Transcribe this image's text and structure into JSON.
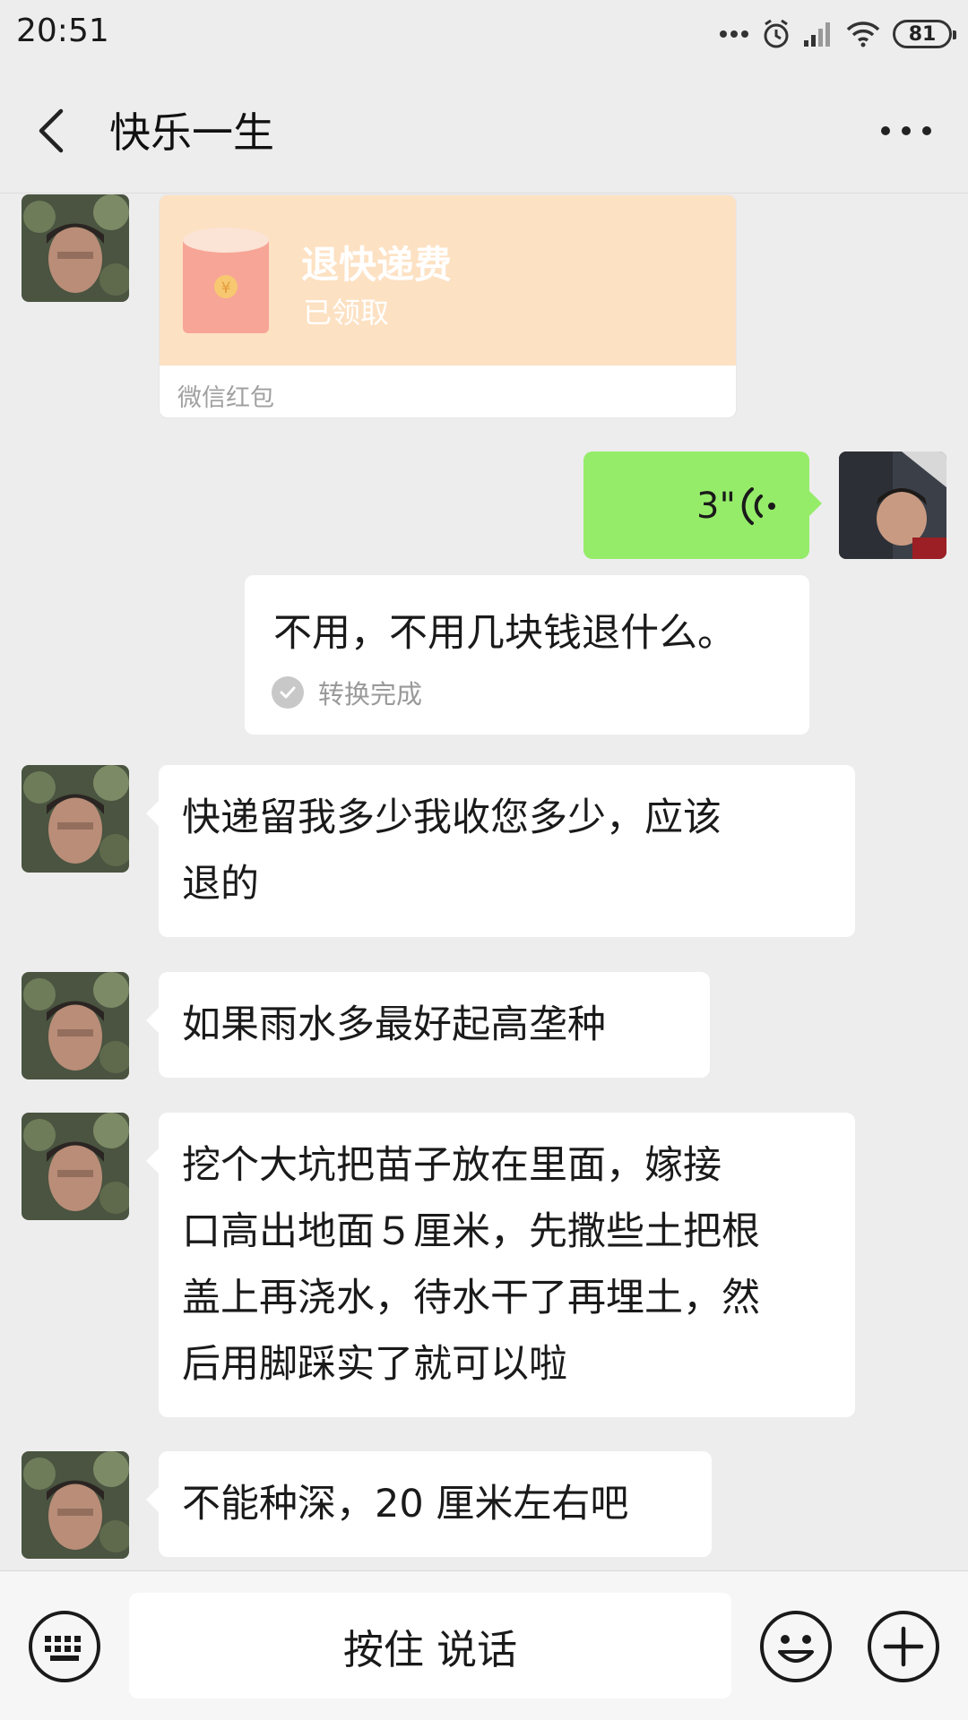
{
  "status_bar": {
    "time": "20:51",
    "battery": "81",
    "icons": [
      "more-dots-icon",
      "alarm-icon",
      "signal-icon",
      "wifi-icon",
      "battery-icon"
    ]
  },
  "header": {
    "title": "快乐一生",
    "back_icon": "chevron-left-icon",
    "more_icon": "more-horizontal-icon"
  },
  "messages": {
    "red_packet": {
      "title": "退快递费",
      "status": "已领取",
      "footer": "微信红包",
      "color": "#fde1c3"
    },
    "voice": {
      "duration": "3\"",
      "color": "#95ec69"
    },
    "transcript": {
      "text": "不用，不用几块钱退什么。",
      "status": "转换完成"
    },
    "m1": {
      "lines": [
        "快递留我多少我收您多少，应该",
        "退的"
      ]
    },
    "m2": {
      "lines": [
        "如果雨水多最好起高垄种"
      ]
    },
    "m3": {
      "lines": [
        "挖个大坑把苗子放在里面，嫁接",
        "口高出地面５厘米，先撒些土把根",
        "盖上再浇水，待水干了再埋土，然",
        "后用脚踩实了就可以啦"
      ]
    },
    "m4": {
      "lines": [
        "不能种深，20 厘米左右吧"
      ]
    }
  },
  "input_bar": {
    "hold_to_talk": "按住 说话",
    "keyboard_icon": "keyboard-icon",
    "emoji_icon": "emoji-icon",
    "plus_icon": "plus-icon"
  }
}
